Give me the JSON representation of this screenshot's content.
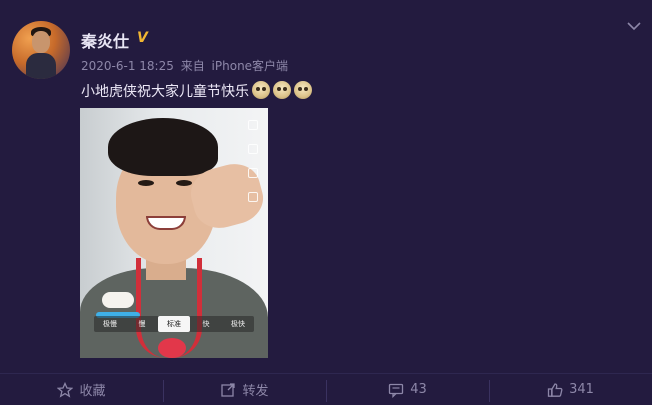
{
  "post": {
    "username": "秦炎仕",
    "verified_mark": "V",
    "date": "2020-6-1 18:25",
    "source_prefix": "来自",
    "source": "iPhone客户端",
    "text": "小地虎侠祝大家儿童节快乐",
    "emoji_count": 3
  },
  "photo": {
    "speed_options": [
      "极慢",
      "慢",
      "标准",
      "快",
      "极快"
    ],
    "selected_speed": "标准"
  },
  "actions": {
    "favorite_label": "收藏",
    "repost_label": "转发",
    "comment_count": "43",
    "like_count": "341"
  },
  "colors": {
    "background": "#231b3f",
    "verified": "#f2b632",
    "muted_text": "#8d87a8"
  },
  "icons": [
    "avatar",
    "verified-icon",
    "chevron-down-icon",
    "emoji-icon",
    "star-icon",
    "repost-icon",
    "comment-icon",
    "like-icon"
  ]
}
